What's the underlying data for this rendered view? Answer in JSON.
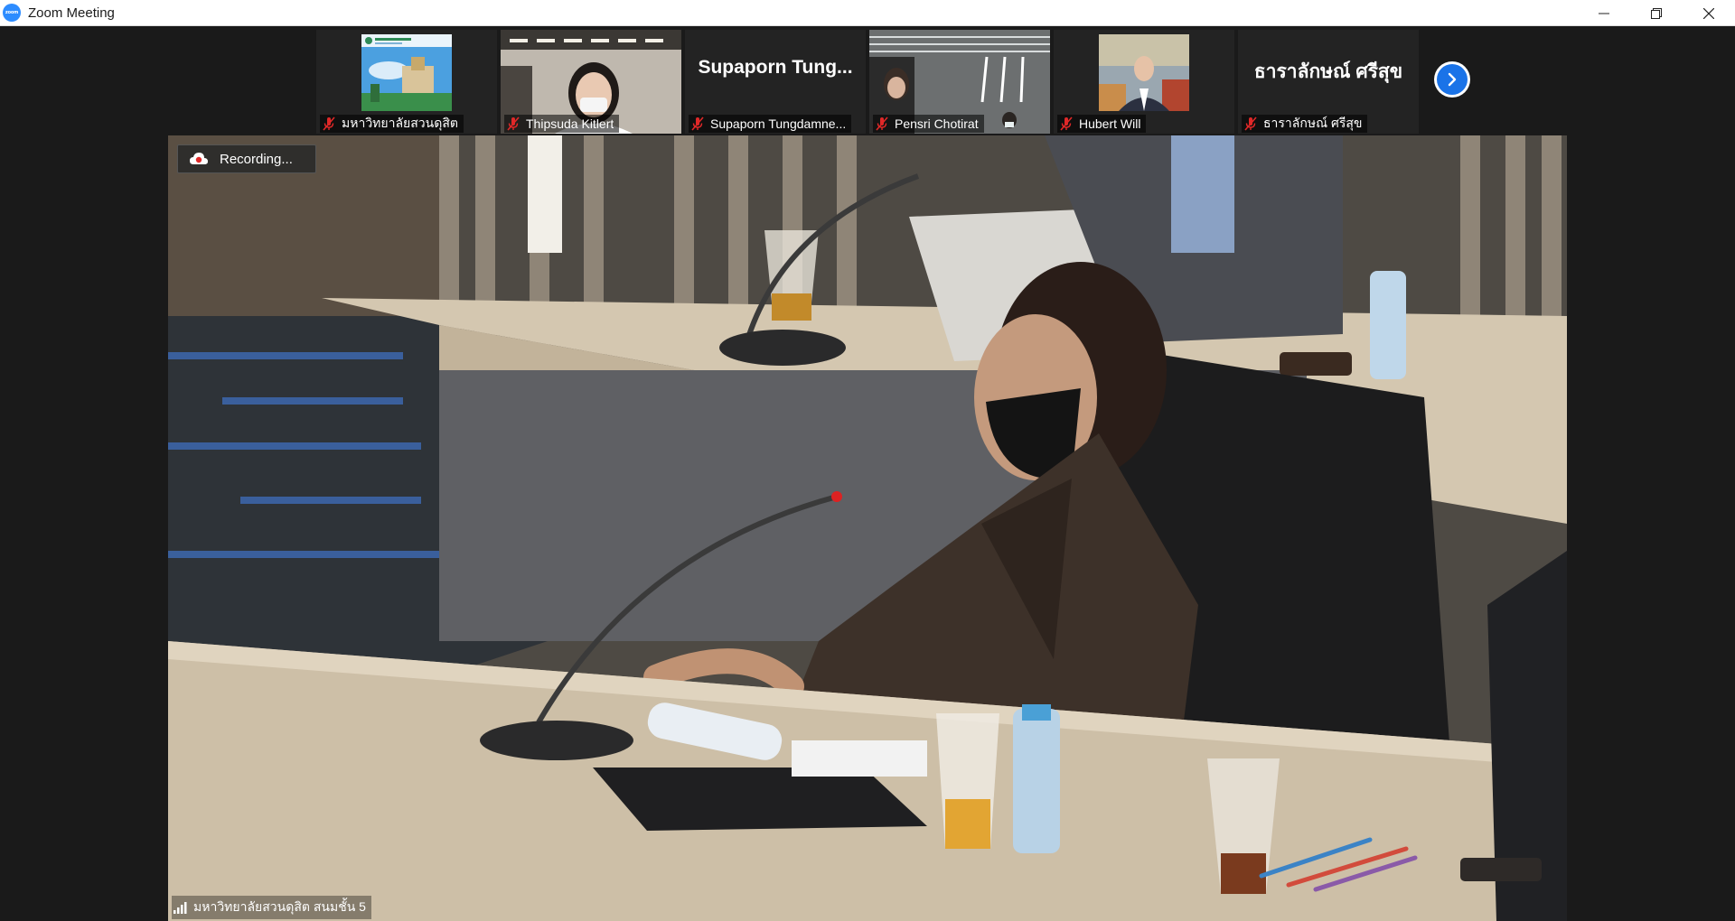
{
  "window": {
    "title": "Zoom Meeting",
    "logo_text": "zoom",
    "controls": [
      "minimize",
      "restore",
      "close"
    ]
  },
  "participants": [
    {
      "name": "มหาวิทยาลัยสวนดุสิต",
      "muted": true,
      "display": "image"
    },
    {
      "name": "Thipsuda Kitlert",
      "muted": true,
      "display": "video"
    },
    {
      "name": "Supaporn Tungdamne...",
      "big_name": "Supaporn Tung...",
      "muted": true,
      "display": "name"
    },
    {
      "name": "Pensri Chotirat",
      "muted": true,
      "display": "video"
    },
    {
      "name": "Hubert Will",
      "muted": true,
      "display": "image"
    },
    {
      "name": "ธาราลักษณ์ ศรีสุข",
      "big_name": "ธาราลักษณ์ ศรีสุข",
      "muted": true,
      "display": "name"
    }
  ],
  "main_video": {
    "recording_label": "Recording...",
    "speaker_label": "มหาวิทยาลัยสวนดุสิต สนมชั้น 5"
  },
  "colors": {
    "accent": "#1a73e8",
    "muted_icon": "#e02828",
    "recording_dot": "#e02828"
  }
}
